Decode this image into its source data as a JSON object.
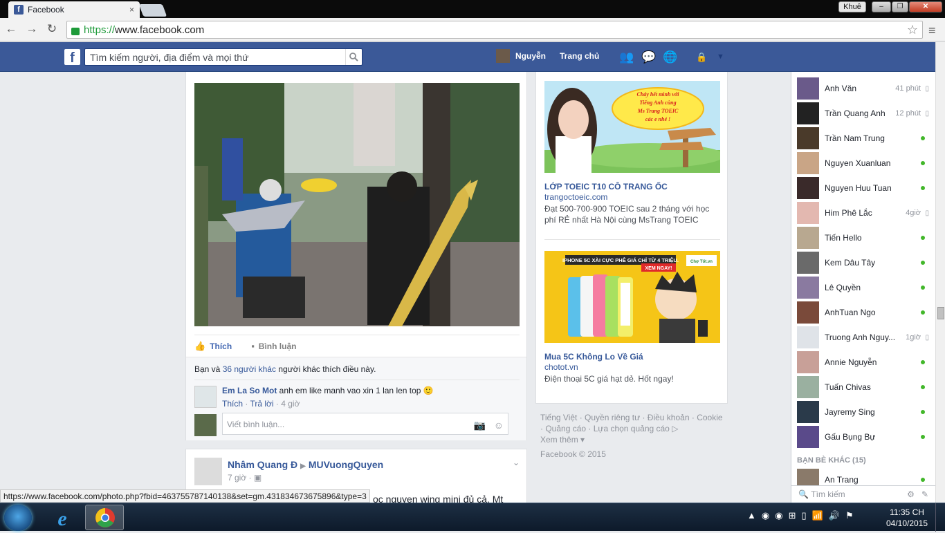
{
  "browser": {
    "tab_title": "Facebook",
    "tab_close": "×",
    "user_badge": "Khuê",
    "url_scheme": "https://",
    "url_rest": "www.facebook.com",
    "status_url": "https://www.facebook.com/photo.php?fbid=463755787140138&set=gm.431834673675896&type=3"
  },
  "header": {
    "logo": "f",
    "search_placeholder": "Tìm kiếm người, địa điểm và mọi thứ",
    "user_name": "Nguyễn",
    "home_label": "Trang chủ"
  },
  "post1": {
    "like_label": "Thích",
    "comment_label": "Bình luận",
    "likes_prefix": "Bạn và ",
    "likes_link": "36 người khác",
    "likes_suffix": " người khác thích điều này.",
    "comment": {
      "author": "Em La So Mot",
      "text": " anh em like manh vao xin 1 lan len top 🙂",
      "like": "Thích",
      "reply": "Trả lời",
      "time": "4 giờ"
    },
    "comment_placeholder": "Viết bình luận..."
  },
  "post2": {
    "author": "Nhâm Quang Đ",
    "group": "MUVuongQuyen",
    "time": "7 giờ",
    "body_partial": "ọc nguyen wing mini đủ cả. Mt"
  },
  "ads": [
    {
      "title": "LỚP TOEIC T10 CÔ TRANG ỐC",
      "url": "trangoctoeic.com",
      "desc": "Đạt 500-700-900 TOEIC sau 2 tháng với học phí RẺ nhất Hà Nội cùng MsTrang TOEIC",
      "bubble": "Cháy hết mình với Tiếng Anh cùng Ms Trang TOEIC các e nhé !"
    },
    {
      "title": "Mua 5C Không Lo Về Giá",
      "url": "chotot.vn",
      "desc": "Điện thoại 5C giá hạt dẻ. Hốt ngay!",
      "banner": "IPHONE 5C XÀI CỰC PHÊ GIÁ CHỈ TỪ 4 TRIỆU.",
      "cta": "XEM NGAY!",
      "brand": "Chợ Tốt.vn"
    }
  ],
  "footer": {
    "links": [
      "Tiếng Việt",
      "Quyền riêng tư",
      "Điều khoản",
      "Cookie",
      "Quảng cáo",
      "Lựa chọn quảng cáo",
      "Xem thêm"
    ],
    "copyright": "Facebook © 2015"
  },
  "chat": {
    "contacts": [
      {
        "name": "Anh Văn",
        "status": "41 phút",
        "color": "#6a5a8a"
      },
      {
        "name": "Trần Quang Anh",
        "status": "12 phút",
        "color": "#222222"
      },
      {
        "name": "Trần Nam Trung",
        "status": "online",
        "color": "#4a3a2a"
      },
      {
        "name": "Nguyen Xuanluan",
        "status": "online",
        "color": "#c9a586"
      },
      {
        "name": "Nguyen Huu Tuan",
        "status": "online",
        "color": "#3a2a2a"
      },
      {
        "name": "Him Phê Lắc",
        "status": "4giờ",
        "color": "#e3b8b0"
      },
      {
        "name": "Tiến Hello",
        "status": "online",
        "color": "#b8a890"
      },
      {
        "name": "Kem Dâu Tây",
        "status": "online",
        "color": "#6a6a6a"
      },
      {
        "name": "Lê Quyền",
        "status": "online",
        "color": "#8a7aa0"
      },
      {
        "name": "AnhTuan Ngo",
        "status": "online",
        "color": "#7a4a3a"
      },
      {
        "name": "Truong Anh Nguy...",
        "status": "1giờ",
        "color": "#dfe3e8"
      },
      {
        "name": "Annie Nguyễn",
        "status": "online",
        "color": "#c8a098"
      },
      {
        "name": "Tuấn Chivas",
        "status": "online",
        "color": "#9ab0a0"
      },
      {
        "name": "Jayremy Sing",
        "status": "online",
        "color": "#2a3a4a"
      },
      {
        "name": "Gấu Bụng Bự",
        "status": "online",
        "color": "#5a4a8a"
      }
    ],
    "others_header": "BẠN BÈ KHÁC (15)",
    "others": [
      {
        "name": "An Trang",
        "status": "online",
        "color": "#8a7a6a"
      }
    ],
    "search_placeholder": "Tìm kiếm"
  },
  "taskbar": {
    "time": "11:35 CH",
    "date": "04/10/2015"
  },
  "colors": {
    "fb_blue": "#3b5998",
    "link": "#365899",
    "online": "#42b72a"
  }
}
